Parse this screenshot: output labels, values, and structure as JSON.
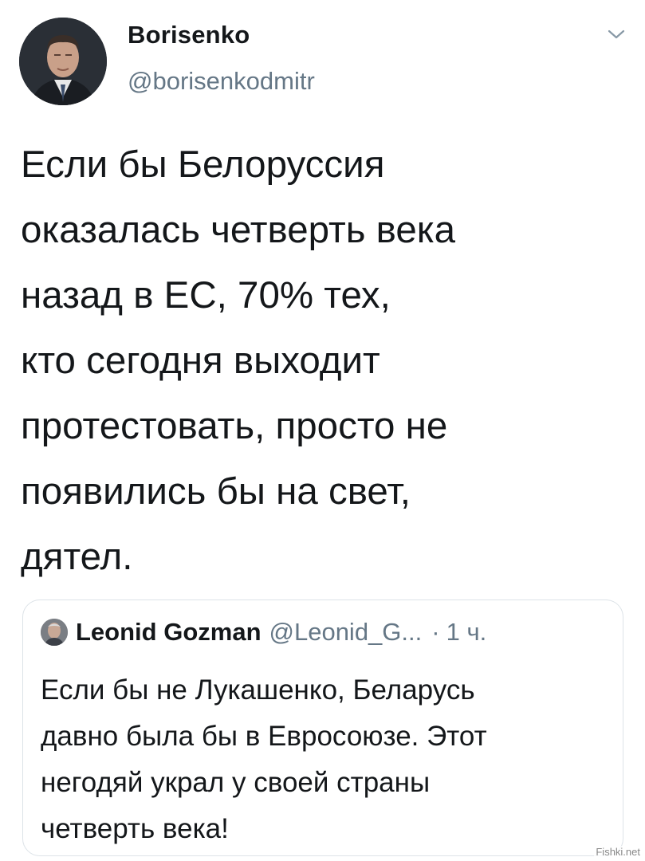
{
  "tweet": {
    "author_name": "Borisenko",
    "author_handle": "@borisenkodmitr",
    "text": "Если бы Белоруссия\nоказалась четверть века\nназад в ЕС,  70% тех,\nкто сегодня выходит\nпротестовать,  просто не\nпоявились бы на свет,\nдятел.",
    "menu_icon": "chevron-down-icon"
  },
  "quoted_tweet": {
    "author_name": "Leonid Gozman",
    "author_handle": "@Leonid_G...",
    "separator": "·",
    "time": "1 ч.",
    "text": "Если бы не Лукашенко, Беларусь\nдавно была бы в Евросоюзе. Этот\nнегодяй украл у своей страны\nчетверть века!"
  },
  "watermark": "Fishki.net",
  "colors": {
    "text": "#14171a",
    "secondary": "#657786",
    "border": "#dde3e8"
  }
}
